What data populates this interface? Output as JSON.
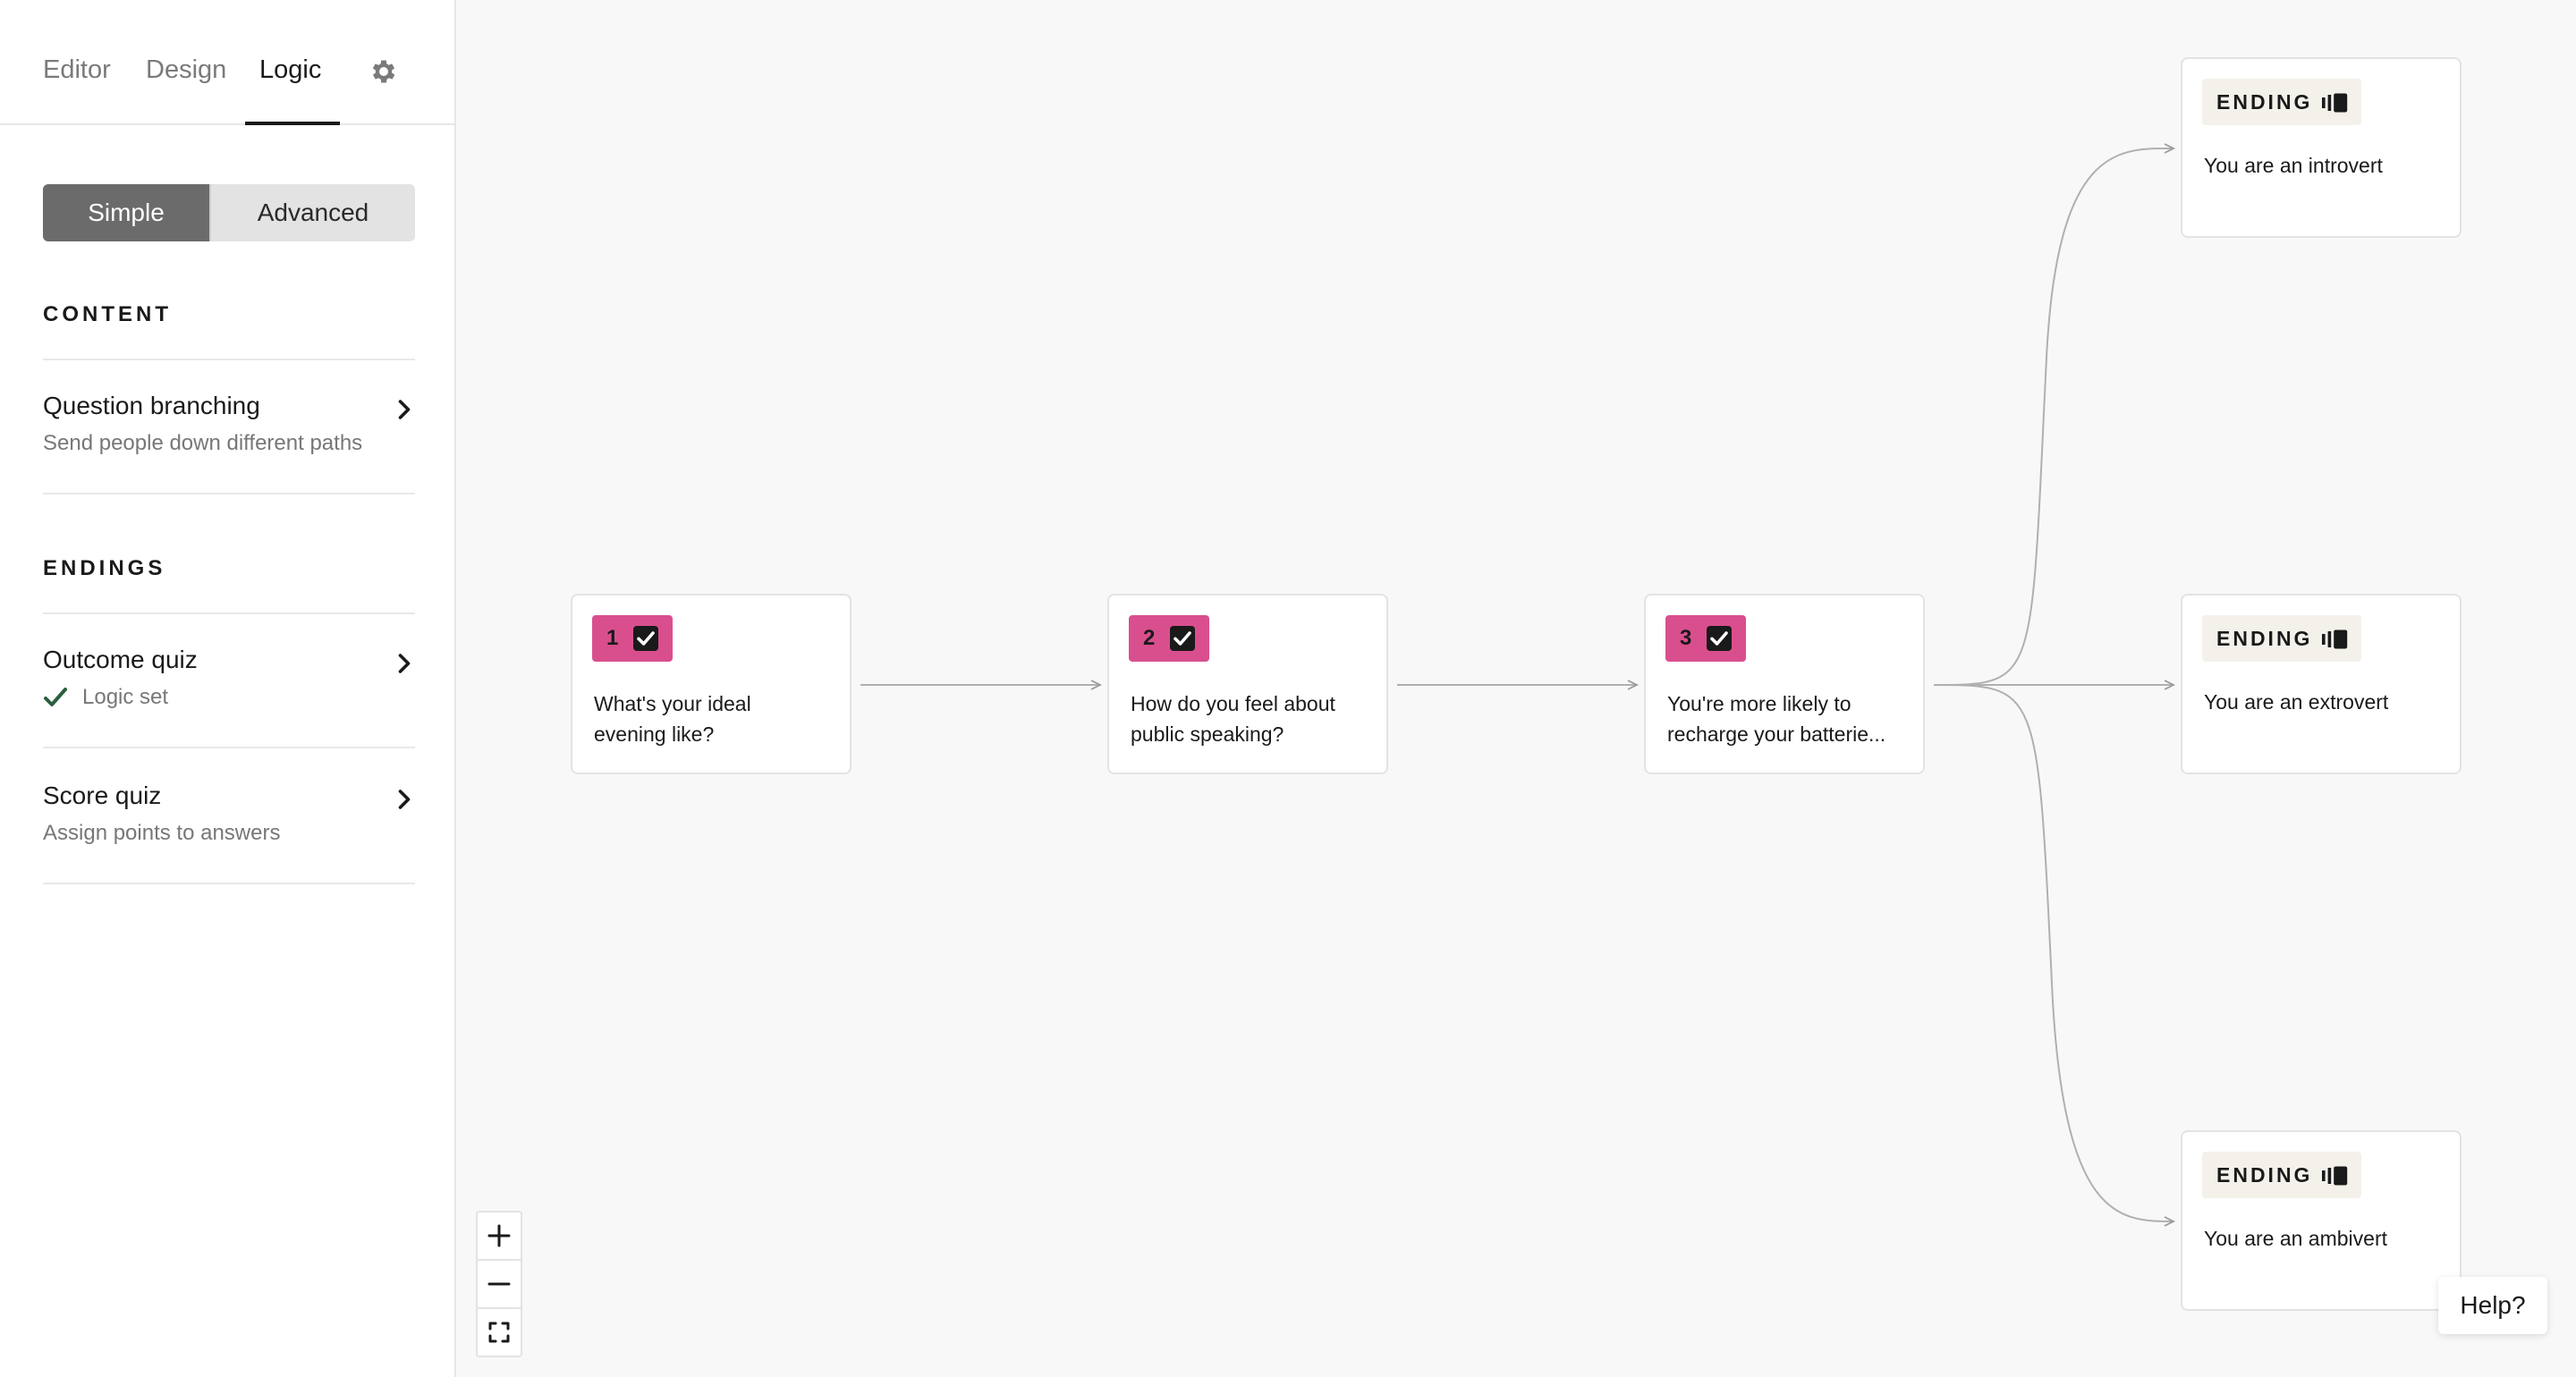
{
  "tabs": [
    {
      "label": "Editor",
      "active": false
    },
    {
      "label": "Design",
      "active": false
    },
    {
      "label": "Logic",
      "active": true
    }
  ],
  "settings_icon": "gear-icon",
  "mode_toggle": {
    "simple_label": "Simple",
    "advanced_label": "Advanced",
    "selected": "Simple"
  },
  "content_section": {
    "title": "CONTENT",
    "items": [
      {
        "title": "Question branching",
        "subtitle": "Send people down different paths"
      }
    ]
  },
  "endings_section": {
    "title": "ENDINGS",
    "items": [
      {
        "title": "Outcome quiz",
        "subtitle": "Logic set",
        "status": "check"
      },
      {
        "title": "Score quiz",
        "subtitle": "Assign points to answers"
      }
    ]
  },
  "flow": {
    "questions": [
      {
        "number": "1",
        "line1": "What's your ideal",
        "line2": "evening like?"
      },
      {
        "number": "2",
        "line1": "How do you feel about",
        "line2": "public speaking?"
      },
      {
        "number": "3",
        "line1": "You're more likely to",
        "line2": "recharge your batterie..."
      }
    ],
    "endings": [
      {
        "label": "ENDING",
        "text": "You are an introvert"
      },
      {
        "label": "ENDING",
        "text": "You are an extrovert"
      },
      {
        "label": "ENDING",
        "text": "You are an ambivert"
      }
    ]
  },
  "help_label": "Help?",
  "colors": {
    "question_badge": "#d94f8e",
    "ending_badge": "#f3f1ea",
    "canvas_bg": "#f8f8f8",
    "toggle_selected": "#6b6b6b"
  }
}
